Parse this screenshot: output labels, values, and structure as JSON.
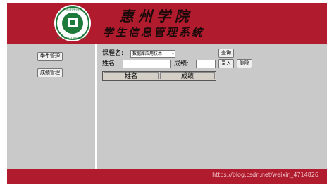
{
  "header": {
    "title_main": "惠州学院",
    "title_sub": "学生信息管理系统",
    "logo": {
      "icon": "huizhou-university-seal",
      "text": "HUIZHOU UNIVERSITY",
      "top_text": "惠州学院"
    }
  },
  "sidebar": {
    "items": [
      {
        "label": "学生管理"
      },
      {
        "label": "成绩管理"
      }
    ]
  },
  "form": {
    "course_label": "课程名:",
    "course_value": "数据库应用技术",
    "query_label": "查询",
    "name_label": "姓名:",
    "name_value": "",
    "score_label": "成绩:",
    "score_value": "",
    "enter_label": "录入",
    "delete_label": "删除"
  },
  "table": {
    "columns": [
      "姓名",
      "成绩"
    ]
  },
  "footer": {
    "watermark": "https://blog.csdn.net/weixin_4714826"
  },
  "colors": {
    "banner": "#b01c2e",
    "content_bg": "#c9c9c9"
  }
}
